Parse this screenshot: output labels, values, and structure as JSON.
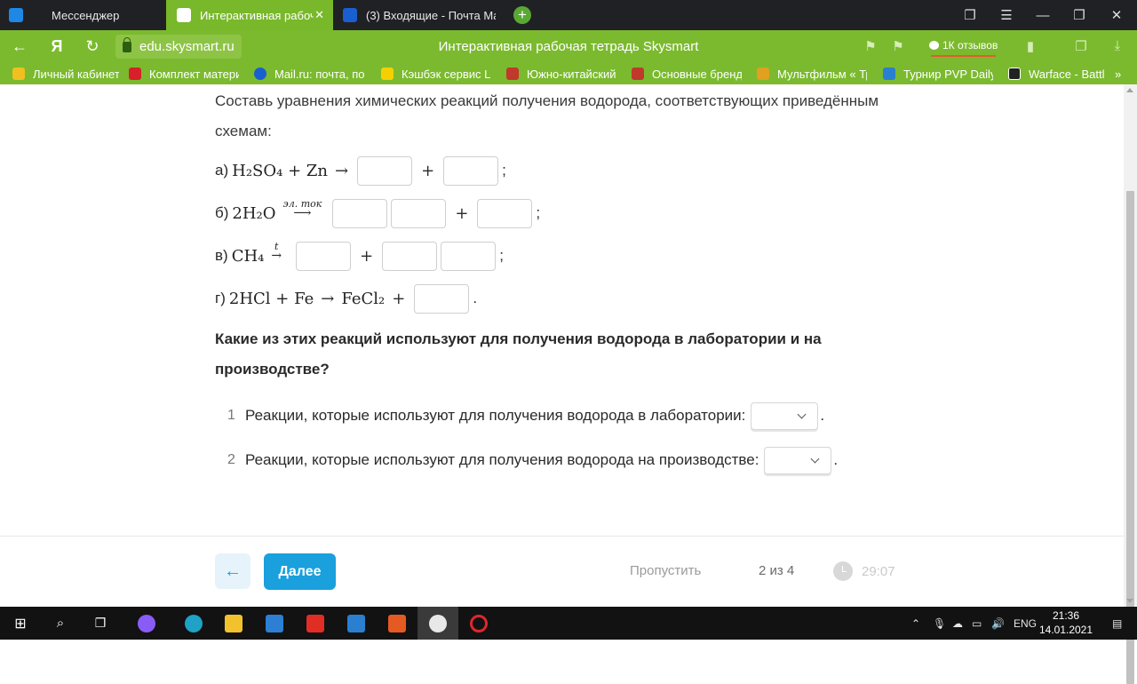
{
  "browser": {
    "tabs": [
      {
        "label": "Мессенджер",
        "icon": "messenger-icon",
        "active": false
      },
      {
        "label": "Интерактивная рабоча",
        "icon": "skysmart-icon",
        "active": true
      },
      {
        "label": "(3) Входящие - Почта Mail",
        "icon": "mail-icon",
        "active": false
      }
    ],
    "url": "edu.skysmart.ru",
    "page_title": "Интерактивная рабочая тетрадь Skysmart",
    "reviews_label": "1К отзывов",
    "bookmarks": [
      {
        "label": "Личный кабинет",
        "color": "#f0c020"
      },
      {
        "label": "Комплект матери",
        "color": "#d8202a"
      },
      {
        "label": "Mail.ru: почта, пои",
        "color": "#1a5fd0"
      },
      {
        "label": "Кэшбэк сервис Le",
        "color": "#f5d000"
      },
      {
        "label": "Южно-китайский",
        "color": "#c0392b"
      },
      {
        "label": "Основные бренды",
        "color": "#c0392b"
      },
      {
        "label": "Мультфильм « Тр",
        "color": "#e0a020"
      },
      {
        "label": "Турнир PVP Daily",
        "color": "#2a7fd0"
      },
      {
        "label": "Warface - Battle",
        "color": "#222222"
      }
    ]
  },
  "task": {
    "intro_line1": "Составь уравнения химических реакций получения водорода, соответствующих приведённым",
    "intro_line2": "схемам:",
    "reactions": {
      "a": {
        "label": "а)",
        "lhs": "H₂SO₄ + Zn"
      },
      "b": {
        "label": "б)",
        "lhs": "2H₂O",
        "over_arrow": "эл. ток"
      },
      "v": {
        "label": "в)",
        "lhs": "CH₄",
        "over_arrow": "t"
      },
      "g": {
        "label": "г)",
        "lhs": "2HCl + Fe",
        "product": "FeCl₂"
      }
    },
    "question_line1": "Какие из этих реакций используют для получения водорода в лаборатории и на",
    "question_line2": "производстве?",
    "selects": [
      {
        "num": "1",
        "text": "Реакции, которые используют для получения водорода в лаборатории:"
      },
      {
        "num": "2",
        "text": "Реакции, которые используют для получения водорода на производстве:"
      }
    ]
  },
  "footer": {
    "next_label": "Далее",
    "skip_label": "Пропустить",
    "progress": "2 из 4",
    "timer": "29:07"
  },
  "taskbar": {
    "lang": "ENG",
    "time": "21:36",
    "date": "14.01.2021"
  }
}
